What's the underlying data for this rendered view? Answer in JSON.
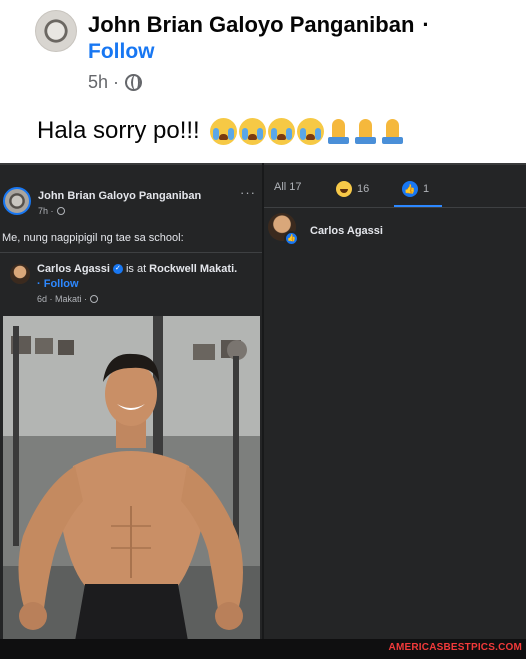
{
  "top_post": {
    "author": "John Brian Galoyo Panganiban",
    "separator": "·",
    "follow": "Follow",
    "time": "5h ·",
    "text": "Hala sorry po!!!",
    "emojis": [
      "loudly-crying-face-icon",
      "loudly-crying-face-icon",
      "loudly-crying-face-icon",
      "loudly-crying-face-icon",
      "folded-hands-icon",
      "folded-hands-icon",
      "folded-hands-icon"
    ]
  },
  "left_post": {
    "author": "John Brian Galoyo Panganiban",
    "time": "7h ·",
    "more": "···",
    "caption": "Me, nung nagpipigil ng tae sa school:",
    "shared": {
      "author": "Carlos Agassi",
      "is_at": "is at",
      "place": "Rockwell Makati.",
      "follow": "· Follow",
      "time": "6d · Makati ·"
    }
  },
  "reactions": {
    "all_label": "All 17",
    "haha_count": "16",
    "like_count": "1",
    "reactor_name": "Carlos Agassi"
  },
  "watermark": "AMERICASBESTPICS.COM",
  "colors": {
    "facebook_blue": "#1877f2",
    "dark_bg": "#242526",
    "watermark_red": "#f23a3a"
  }
}
